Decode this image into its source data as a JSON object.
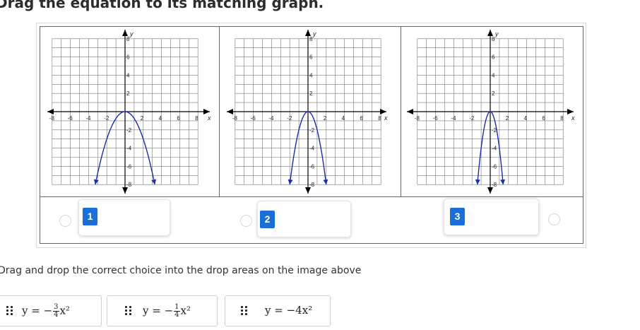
{
  "heading": "Drag the equation to its matching graph.",
  "instruction": "Drag and drop the correct choice into the drop areas on the image above",
  "graphs": [
    {
      "a": -0.75,
      "x_labels": [
        "-8",
        "-6",
        "-4",
        "-2",
        "2",
        "4",
        "6",
        "8"
      ],
      "y_labels": [
        "8",
        "6",
        "4",
        "2",
        "-2",
        "-4",
        "-6",
        "-8"
      ],
      "x_axis_label": "x",
      "y_axis_label": "y"
    },
    {
      "a": -2,
      "x_labels": [
        "-8",
        "-6",
        "-4",
        "-2",
        "2",
        "4",
        "6",
        "8"
      ],
      "y_labels": [
        "8",
        "6",
        "4",
        "2",
        "-2",
        "-4",
        "-6",
        "-8"
      ],
      "x_axis_label": "x",
      "y_axis_label": "y"
    },
    {
      "a": -4,
      "x_labels": [
        "-8",
        "-6",
        "-4",
        "-2",
        "2",
        "4",
        "6",
        "8"
      ],
      "y_labels": [
        "8",
        "6",
        "4",
        "2",
        "-2",
        "-4",
        "-6",
        "-8"
      ],
      "x_axis_label": "x",
      "y_axis_label": "y"
    }
  ],
  "drop_zones": [
    {
      "number": "1"
    },
    {
      "number": "2"
    },
    {
      "number": "3"
    }
  ],
  "choices": [
    {
      "lhs": "y = −",
      "num": "3",
      "den": "4",
      "rhs": "x²"
    },
    {
      "lhs": "y = −",
      "num": "1",
      "den": "4",
      "rhs": "x²"
    },
    {
      "lhs": "y = −4x²",
      "num": "",
      "den": "",
      "rhs": ""
    }
  ],
  "colors": {
    "curve": "#1d2fa8",
    "badge": "#1a6fd8",
    "grid": "#777777",
    "axis": "#000000"
  },
  "chart_data": [
    {
      "type": "line",
      "function": "y = a x^2",
      "a": -0.75,
      "xlim": [
        -8,
        8
      ],
      "ylim": [
        -8,
        8
      ],
      "grid": true,
      "xlabel": "x",
      "ylabel": "y"
    },
    {
      "type": "line",
      "function": "y = a x^2",
      "a": -2,
      "xlim": [
        -8,
        8
      ],
      "ylim": [
        -8,
        8
      ],
      "grid": true,
      "xlabel": "x",
      "ylabel": "y"
    },
    {
      "type": "line",
      "function": "y = a x^2",
      "a": -4,
      "xlim": [
        -8,
        8
      ],
      "ylim": [
        -8,
        8
      ],
      "grid": true,
      "xlabel": "x",
      "ylabel": "y"
    }
  ]
}
